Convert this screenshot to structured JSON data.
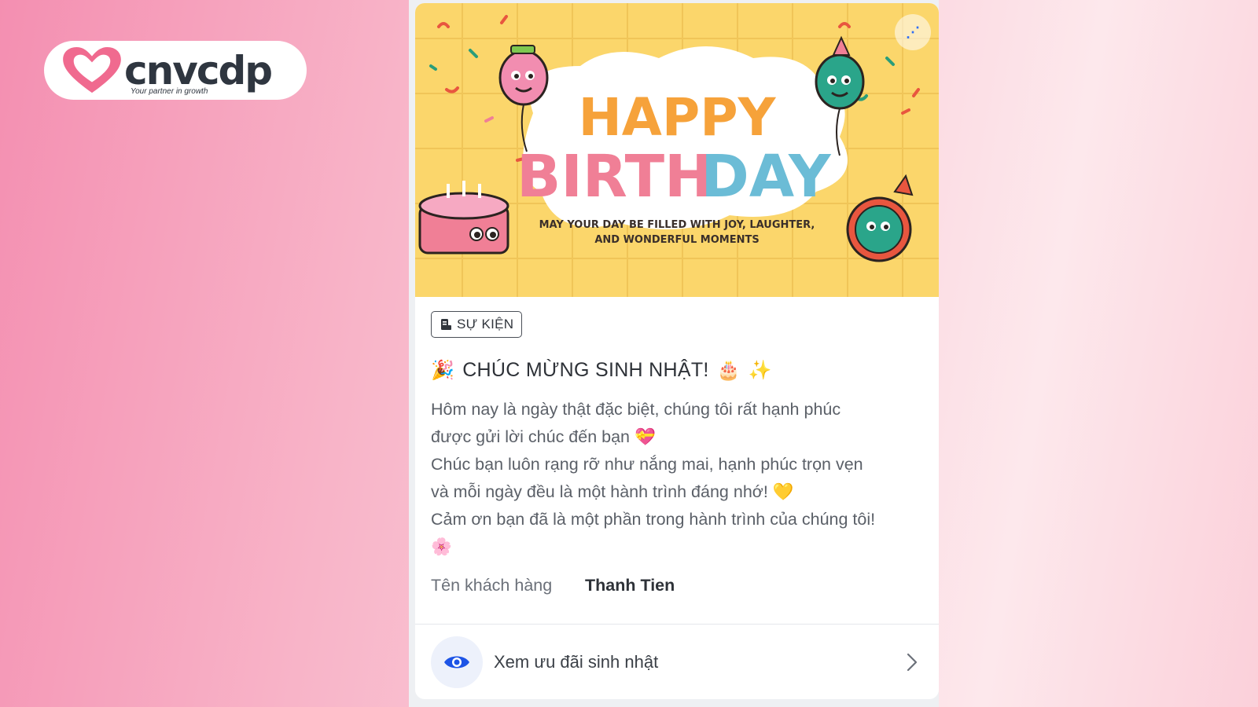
{
  "brand": {
    "name": "cnvcdp",
    "tagline": "Your partner in growth",
    "colors": {
      "heart": "#f06a8f",
      "text": "#2f3640"
    }
  },
  "banner": {
    "headline_line1": "HAPPY",
    "headline_line2_part1": "BIRTH",
    "headline_line2_part2": "DAY",
    "subtitle_line1": "MAY YOUR DAY BE FILLED WITH JOY, LAUGHTER,",
    "subtitle_line2": "AND WONDERFUL MOMENTS",
    "colors": {
      "background": "#fbd66b",
      "happy": "#f6a23a",
      "birth": "#f07f96",
      "day": "#6bbcd6"
    }
  },
  "card": {
    "tag": {
      "icon": "event-icon",
      "label": "SỰ KIỆN"
    },
    "title": {
      "emoji_start": "🎉",
      "text": "CHÚC MỪNG SINH NHẬT!",
      "emoji_cake": "🎂",
      "emoji_sparkle": "✨"
    },
    "message_lines": [
      "Hôm nay là ngày thật đặc biệt, chúng tôi rất hạnh phúc",
      "được gửi lời chúc đến bạn 💝",
      "Chúc bạn luôn rạng rỡ như nắng mai, hạnh phúc trọn vẹn",
      "và mỗi ngày đều là một hành trình đáng nhớ! 💛",
      "Cảm ơn bạn đã là một phần trong hành trình của chúng tôi!",
      "🌸"
    ],
    "customer": {
      "label": "Tên khách hàng",
      "value": "Thanh Tien"
    },
    "action": {
      "icon": "eye-icon",
      "label": "Xem ưu đãi sinh nhật",
      "chevron": "chevron-right-icon"
    }
  }
}
